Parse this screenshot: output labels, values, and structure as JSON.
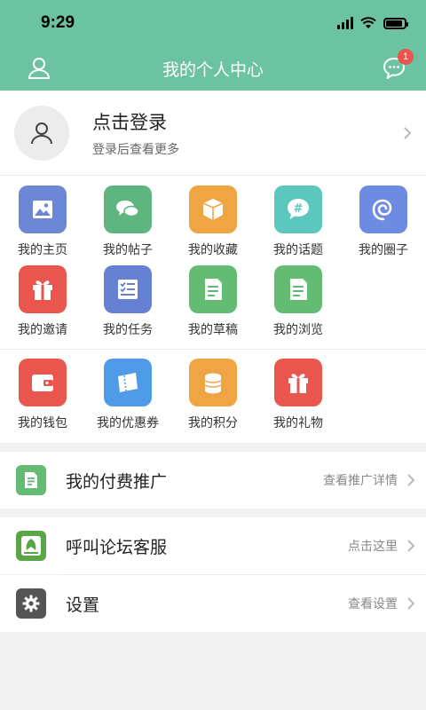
{
  "status_bar": {
    "time": "9:29",
    "battery_level": 0.9
  },
  "nav": {
    "title": "我的个人中心",
    "message_badge": "1",
    "left_icon": "user-icon",
    "right_icon": "message-icon"
  },
  "profile": {
    "title": "点击登录",
    "subtitle": "登录后查看更多"
  },
  "grid": {
    "rows": [
      [
        {
          "label": "我的主页",
          "icon": "image-icon",
          "color": "#6c87d6"
        },
        {
          "label": "我的帖子",
          "icon": "chat-bubbles-icon",
          "color": "#5eb57f"
        },
        {
          "label": "我的收藏",
          "icon": "box-icon",
          "color": "#f0a545"
        },
        {
          "label": "我的话题",
          "icon": "hashtag-icon",
          "color": "#5bc7bd"
        },
        {
          "label": "我的圈子",
          "icon": "swirl-icon",
          "color": "#6d8be2"
        }
      ],
      [
        {
          "label": "我的邀请",
          "icon": "gift-icon",
          "color": "#e8564d"
        },
        {
          "label": "我的任务",
          "icon": "checklist-icon",
          "color": "#6680d4"
        },
        {
          "label": "我的草稿",
          "icon": "document-icon",
          "color": "#63bb74"
        },
        {
          "label": "我的浏览",
          "icon": "document-icon",
          "color": "#63bb74"
        }
      ],
      [
        {
          "label": "我的钱包",
          "icon": "wallet-icon",
          "color": "#e8564d"
        },
        {
          "label": "我的优惠券",
          "icon": "coupon-icon",
          "color": "#4f9be8"
        },
        {
          "label": "我的积分",
          "icon": "coins-icon",
          "color": "#f0a545"
        },
        {
          "label": "我的礼物",
          "icon": "gift-icon",
          "color": "#e8564d"
        }
      ]
    ]
  },
  "promo": {
    "label": "我的付费推广",
    "hint": "查看推广详情",
    "icon": "document-icon",
    "color": "#63bb74"
  },
  "support": {
    "label": "呼叫论坛客服",
    "hint": "点击这里",
    "icon": "app-logo-icon",
    "color": "#5aa646"
  },
  "settings": {
    "label": "设置",
    "hint": "查看设置",
    "icon": "gear-icon",
    "color": "#555555"
  }
}
